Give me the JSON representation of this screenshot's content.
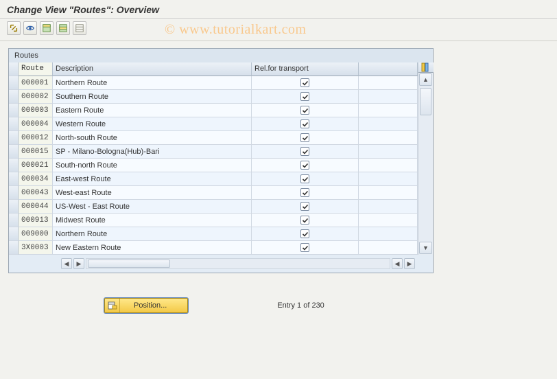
{
  "page_title": "Change View \"Routes\": Overview",
  "watermark": "© www.tutorialkart.com",
  "toolbar": {
    "btn1": "other-view",
    "btn2": "display-change",
    "btn3": "select-all",
    "btn4": "select-block",
    "btn5": "deselect-all"
  },
  "panel": {
    "title": "Routes",
    "columns": {
      "route": "Route",
      "description": "Description",
      "rel": "Rel.for transport"
    },
    "rows": [
      {
        "route": "000001",
        "desc": "Northern Route",
        "rel": true
      },
      {
        "route": "000002",
        "desc": "Southern Route",
        "rel": true
      },
      {
        "route": "000003",
        "desc": "Eastern Route",
        "rel": true
      },
      {
        "route": "000004",
        "desc": "Western Route",
        "rel": true
      },
      {
        "route": "000012",
        "desc": "North-south Route",
        "rel": true
      },
      {
        "route": "000015",
        "desc": "SP - Milano-Bologna(Hub)-Bari",
        "rel": true
      },
      {
        "route": "000021",
        "desc": "South-north Route",
        "rel": true
      },
      {
        "route": "000034",
        "desc": "East-west Route",
        "rel": true
      },
      {
        "route": "000043",
        "desc": "West-east Route",
        "rel": true
      },
      {
        "route": "000044",
        "desc": "US-West - East Route",
        "rel": true
      },
      {
        "route": "000913",
        "desc": "Midwest Route",
        "rel": true
      },
      {
        "route": "009000",
        "desc": "Northern Route",
        "rel": true
      },
      {
        "route": "3X0003",
        "desc": "New Eastern Route",
        "rel": true
      }
    ]
  },
  "footer": {
    "position_label": "Position...",
    "entry_text": "Entry 1 of 230"
  }
}
